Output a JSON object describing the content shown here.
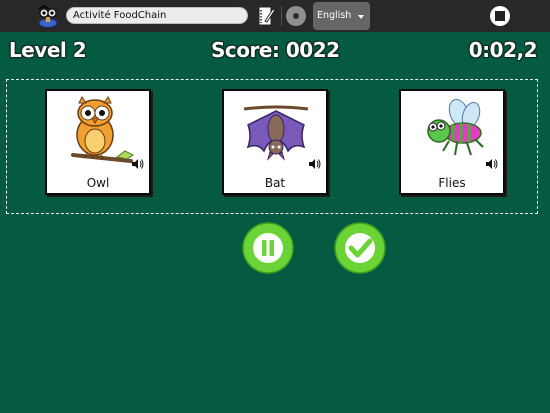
{
  "toolbar": {
    "activity_title": "Activité FoodChain",
    "language": "English",
    "icons": [
      "activity-icon",
      "journal-icon",
      "record-icon",
      "stop-icon"
    ]
  },
  "hud": {
    "level": "Level 2",
    "score": "Score: 0022",
    "timer": "0:02,2"
  },
  "cards": [
    {
      "label": "Owl",
      "icon": "owl-image"
    },
    {
      "label": "Bat",
      "icon": "bat-image"
    },
    {
      "label": "Flies",
      "icon": "fly-image"
    }
  ],
  "controls": {
    "pause_icon": "pause-icon",
    "validate_icon": "checkmark-icon"
  },
  "colors": {
    "background": "#055a42",
    "toolbar": "#282828",
    "button": "#6ad336"
  }
}
